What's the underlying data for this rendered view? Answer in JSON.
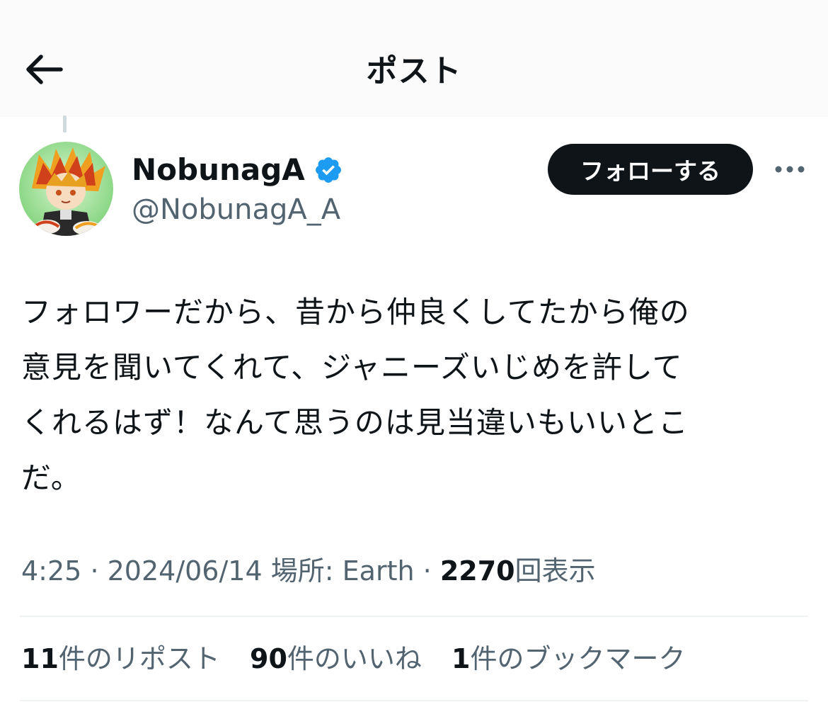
{
  "header": {
    "title": "ポスト",
    "back_icon": "arrow-left-icon"
  },
  "author": {
    "name": "NobunagA",
    "handle": "@NobunagA_A",
    "verified_icon": "verified-badge-icon",
    "follow_label": "フォローする",
    "more_icon": "more-horizontal-icon"
  },
  "tweet": {
    "text": "フォロワーだから、昔から仲良くしてたから俺の\n意見を聞いてくれて、ジャニーズいじめを許して\nくれるはず！なんて思うのは見当違いもいいとこ\nだ。"
  },
  "meta": {
    "time": "4:25",
    "sep1": "·",
    "date": "2024/06/14",
    "location_label": "場所:",
    "location": "Earth",
    "sep2": "·",
    "views": "2270",
    "views_label": "回表示"
  },
  "stats": {
    "reposts": "11",
    "reposts_label": "件のリポスト",
    "likes": "90",
    "likes_label": "件のいいね",
    "bookmarks": "1",
    "bookmarks_label": "件のブックマーク"
  },
  "colors": {
    "text": "#0f1419",
    "secondary": "#536471",
    "verified": "#1d9bf0",
    "follow_bg": "#0f1419",
    "divider": "#eff3f4"
  }
}
